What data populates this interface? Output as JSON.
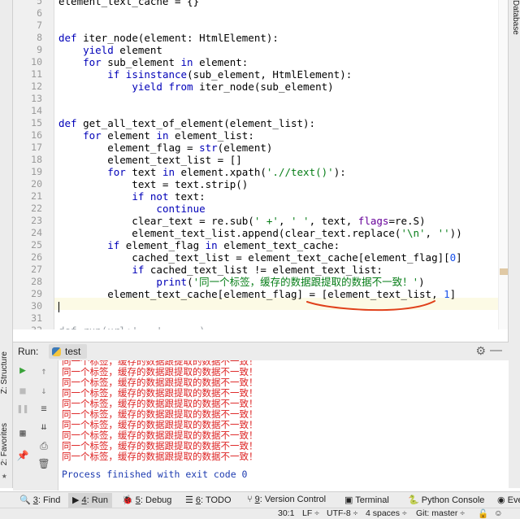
{
  "editor": {
    "line_numbers": [
      "5",
      "6",
      "7",
      "8",
      "9",
      "10",
      "11",
      "12",
      "13",
      "14",
      "15",
      "16",
      "17",
      "18",
      "19",
      "20",
      "21",
      "22",
      "23",
      "24",
      "25",
      "26",
      "27",
      "28",
      "29",
      "30",
      "31",
      "32"
    ],
    "lines": [
      {
        "n": "5",
        "segs": [
          {
            "t": "element_text_cache = {}",
            "c": ""
          }
        ]
      },
      {
        "n": "6",
        "segs": []
      },
      {
        "n": "7",
        "segs": []
      },
      {
        "n": "8",
        "segs": [
          {
            "t": "def ",
            "c": "kw"
          },
          {
            "t": "iter_node(element: HtmlElement):",
            "c": ""
          }
        ]
      },
      {
        "n": "9",
        "segs": [
          {
            "t": "    ",
            "c": ""
          },
          {
            "t": "yield ",
            "c": "kw"
          },
          {
            "t": "element",
            "c": ""
          }
        ]
      },
      {
        "n": "10",
        "segs": [
          {
            "t": "    ",
            "c": ""
          },
          {
            "t": "for ",
            "c": "kw"
          },
          {
            "t": "sub_element ",
            "c": ""
          },
          {
            "t": "in ",
            "c": "kw"
          },
          {
            "t": "element:",
            "c": ""
          }
        ]
      },
      {
        "n": "11",
        "segs": [
          {
            "t": "        ",
            "c": ""
          },
          {
            "t": "if ",
            "c": "kw"
          },
          {
            "t": "isinstance",
            "c": "bi"
          },
          {
            "t": "(sub_element, HtmlElement):",
            "c": ""
          }
        ]
      },
      {
        "n": "12",
        "segs": [
          {
            "t": "            ",
            "c": ""
          },
          {
            "t": "yield from ",
            "c": "kw"
          },
          {
            "t": "iter_node(sub_element)",
            "c": ""
          }
        ]
      },
      {
        "n": "13",
        "segs": []
      },
      {
        "n": "14",
        "segs": []
      },
      {
        "n": "15",
        "segs": [
          {
            "t": "def ",
            "c": "kw"
          },
          {
            "t": "get_all_text_of_element(element_list):",
            "c": ""
          }
        ]
      },
      {
        "n": "16",
        "segs": [
          {
            "t": "    ",
            "c": ""
          },
          {
            "t": "for ",
            "c": "kw"
          },
          {
            "t": "element ",
            "c": ""
          },
          {
            "t": "in ",
            "c": "kw"
          },
          {
            "t": "element_list:",
            "c": ""
          }
        ]
      },
      {
        "n": "17",
        "segs": [
          {
            "t": "        element_flag = ",
            "c": ""
          },
          {
            "t": "str",
            "c": "bi"
          },
          {
            "t": "(element)",
            "c": ""
          }
        ]
      },
      {
        "n": "18",
        "segs": [
          {
            "t": "        element_text_list = []",
            "c": ""
          }
        ]
      },
      {
        "n": "19",
        "segs": [
          {
            "t": "        ",
            "c": ""
          },
          {
            "t": "for ",
            "c": "kw"
          },
          {
            "t": "text ",
            "c": ""
          },
          {
            "t": "in ",
            "c": "kw"
          },
          {
            "t": "element.xpath(",
            "c": ""
          },
          {
            "t": "'.//text()'",
            "c": "str"
          },
          {
            "t": "):",
            "c": ""
          }
        ]
      },
      {
        "n": "20",
        "segs": [
          {
            "t": "            text = text.strip()",
            "c": ""
          }
        ]
      },
      {
        "n": "21",
        "segs": [
          {
            "t": "            ",
            "c": ""
          },
          {
            "t": "if not ",
            "c": "kw"
          },
          {
            "t": "text:",
            "c": ""
          }
        ]
      },
      {
        "n": "22",
        "segs": [
          {
            "t": "                ",
            "c": ""
          },
          {
            "t": "continue",
            "c": "kw"
          }
        ]
      },
      {
        "n": "23",
        "segs": [
          {
            "t": "            clear_text = re.sub(",
            "c": ""
          },
          {
            "t": "' +'",
            "c": "str"
          },
          {
            "t": ", ",
            "c": ""
          },
          {
            "t": "' '",
            "c": "str"
          },
          {
            "t": ", text, ",
            "c": ""
          },
          {
            "t": "flags",
            "c": "prm"
          },
          {
            "t": "=re.S)",
            "c": ""
          }
        ]
      },
      {
        "n": "24",
        "segs": [
          {
            "t": "            element_text_list.append(clear_text.replace(",
            "c": ""
          },
          {
            "t": "'\\n'",
            "c": "str"
          },
          {
            "t": ", ",
            "c": ""
          },
          {
            "t": "''",
            "c": "str"
          },
          {
            "t": "))",
            "c": ""
          }
        ]
      },
      {
        "n": "25",
        "segs": [
          {
            "t": "        ",
            "c": ""
          },
          {
            "t": "if ",
            "c": "kw"
          },
          {
            "t": "element_flag ",
            "c": ""
          },
          {
            "t": "in ",
            "c": "kw"
          },
          {
            "t": "element_text_cache:",
            "c": ""
          }
        ]
      },
      {
        "n": "26",
        "segs": [
          {
            "t": "            cached_text_list = element_text_cache[element_flag][",
            "c": ""
          },
          {
            "t": "0",
            "c": "num"
          },
          {
            "t": "]",
            "c": ""
          }
        ]
      },
      {
        "n": "27",
        "segs": [
          {
            "t": "            ",
            "c": ""
          },
          {
            "t": "if ",
            "c": "kw"
          },
          {
            "t": "cached_text_list != element_text_list:",
            "c": ""
          }
        ]
      },
      {
        "n": "28",
        "segs": [
          {
            "t": "                ",
            "c": ""
          },
          {
            "t": "print",
            "c": "bi"
          },
          {
            "t": "(",
            "c": ""
          },
          {
            "t": "'同一个标签，缓存的数据跟提取的数据不一致！'",
            "c": "str"
          },
          {
            "t": ")",
            "c": ""
          }
        ]
      },
      {
        "n": "29",
        "segs": [
          {
            "t": "        element_text_cache[element_flag] = [element_text_list, ",
            "c": ""
          },
          {
            "t": "1",
            "c": "num"
          },
          {
            "t": "]",
            "c": ""
          }
        ]
      },
      {
        "n": "30",
        "segs": []
      },
      {
        "n": "31",
        "segs": []
      },
      {
        "n": "32",
        "segs": [
          {
            "t": "def run(url:'...' , ...)",
            "c": "pdim"
          }
        ]
      }
    ]
  },
  "right_strip": {
    "label": "Database"
  },
  "left_strip": {
    "structure": "Z: Structure",
    "favorites": "2: Favorites"
  },
  "run_panel": {
    "label": "Run:",
    "tab": "test",
    "output_lines": [
      "同一个标签，缓存的数据跟提取的数据不一致！",
      "同一个标签，缓存的数据跟提取的数据不一致！",
      "同一个标签，缓存的数据跟提取的数据不一致！",
      "同一个标签，缓存的数据跟提取的数据不一致！",
      "同一个标签，缓存的数据跟提取的数据不一致！",
      "同一个标签，缓存的数据跟提取的数据不一致！",
      "同一个标签，缓存的数据跟提取的数据不一致！",
      "同一个标签，缓存的数据跟提取的数据不一致！",
      "同一个标签，缓存的数据跟提取的数据不一致！",
      "同一个标签，缓存的数据跟提取的数据不一致！"
    ],
    "exit_message": "Process finished with exit code 0"
  },
  "bottom_tabs": [
    {
      "key": "3",
      "label": ": Find"
    },
    {
      "key": "4",
      "label": ": Run"
    },
    {
      "key": "5",
      "label": ": Debug"
    },
    {
      "key": "6",
      "label": ": TODO"
    },
    {
      "key": "9",
      "label": ": Version Control"
    },
    {
      "key": "",
      "label": "Terminal"
    },
    {
      "key": "",
      "label": "Python Console"
    },
    {
      "key": "",
      "label": "Eve"
    }
  ],
  "status": {
    "position": "30:1",
    "line_sep": "LF ÷",
    "encoding": "UTF-8 ÷",
    "indent": "4 spaces ÷",
    "vcs": "Git: master ÷"
  },
  "colors": {
    "keyword": "#0000b8",
    "string": "#067d17",
    "number": "#1750eb",
    "annotation": "#e0401a",
    "console_error": "#d22222"
  }
}
